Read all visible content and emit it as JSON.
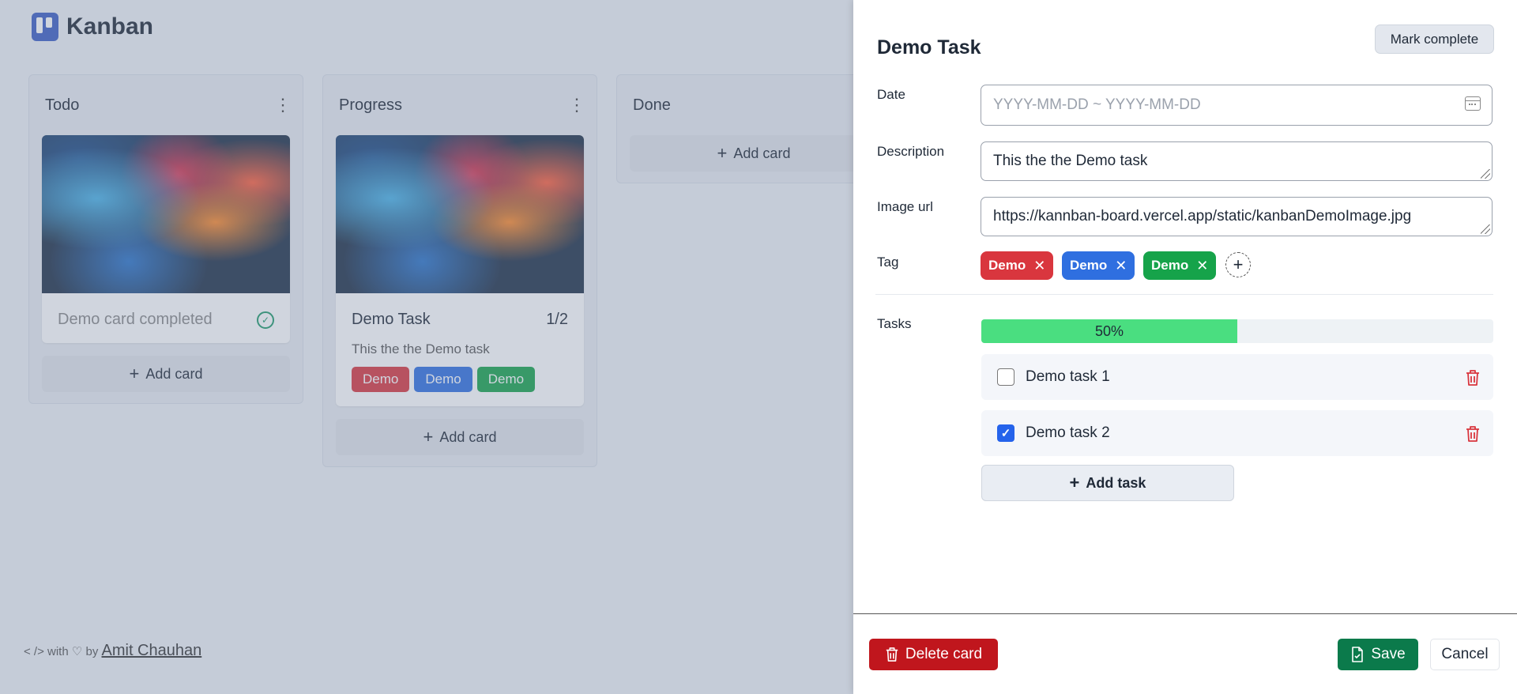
{
  "app": {
    "title": "Kanban"
  },
  "board": {
    "columns": [
      {
        "title": "Todo",
        "card": {
          "title": "Demo card completed"
        },
        "add_label": "Add card"
      },
      {
        "title": "Progress",
        "card": {
          "title": "Demo Task",
          "count": "1/2",
          "description": "This the the Demo task",
          "tags": [
            "Demo",
            "Demo",
            "Demo"
          ]
        },
        "add_label": "Add card"
      },
      {
        "title": "Done",
        "add_label": "Add card"
      }
    ]
  },
  "footer": {
    "prefix": "< /> with ♡ by",
    "author": "Amit Chauhan"
  },
  "drawer": {
    "title": "Demo Task",
    "mark_complete_label": "Mark complete",
    "date": {
      "label": "Date",
      "placeholder": "YYYY-MM-DD ~ YYYY-MM-DD"
    },
    "description": {
      "label": "Description",
      "value": "This the the Demo task"
    },
    "image_url": {
      "label": "Image url",
      "value": "https://kannban-board.vercel.app/static/kanbanDemoImage.jpg"
    },
    "tag": {
      "label": "Tag",
      "items": [
        "Demo",
        "Demo",
        "Demo"
      ]
    },
    "tasks": {
      "label": "Tasks",
      "progress_label": "50%",
      "progress_value": 0.5,
      "items": [
        {
          "name": "Demo task 1",
          "checked": false
        },
        {
          "name": "Demo task 2",
          "checked": true
        }
      ],
      "add_label": "Add task"
    },
    "delete_label": "Delete card",
    "save_label": "Save",
    "cancel_label": "Cancel"
  },
  "colors": {
    "tag_red": "#d9363e",
    "tag_blue": "#2f6fe0",
    "tag_green": "#16a34a",
    "progress_fill": "#4ade80",
    "delete": "#c0161d",
    "save": "#0b7a4b"
  }
}
